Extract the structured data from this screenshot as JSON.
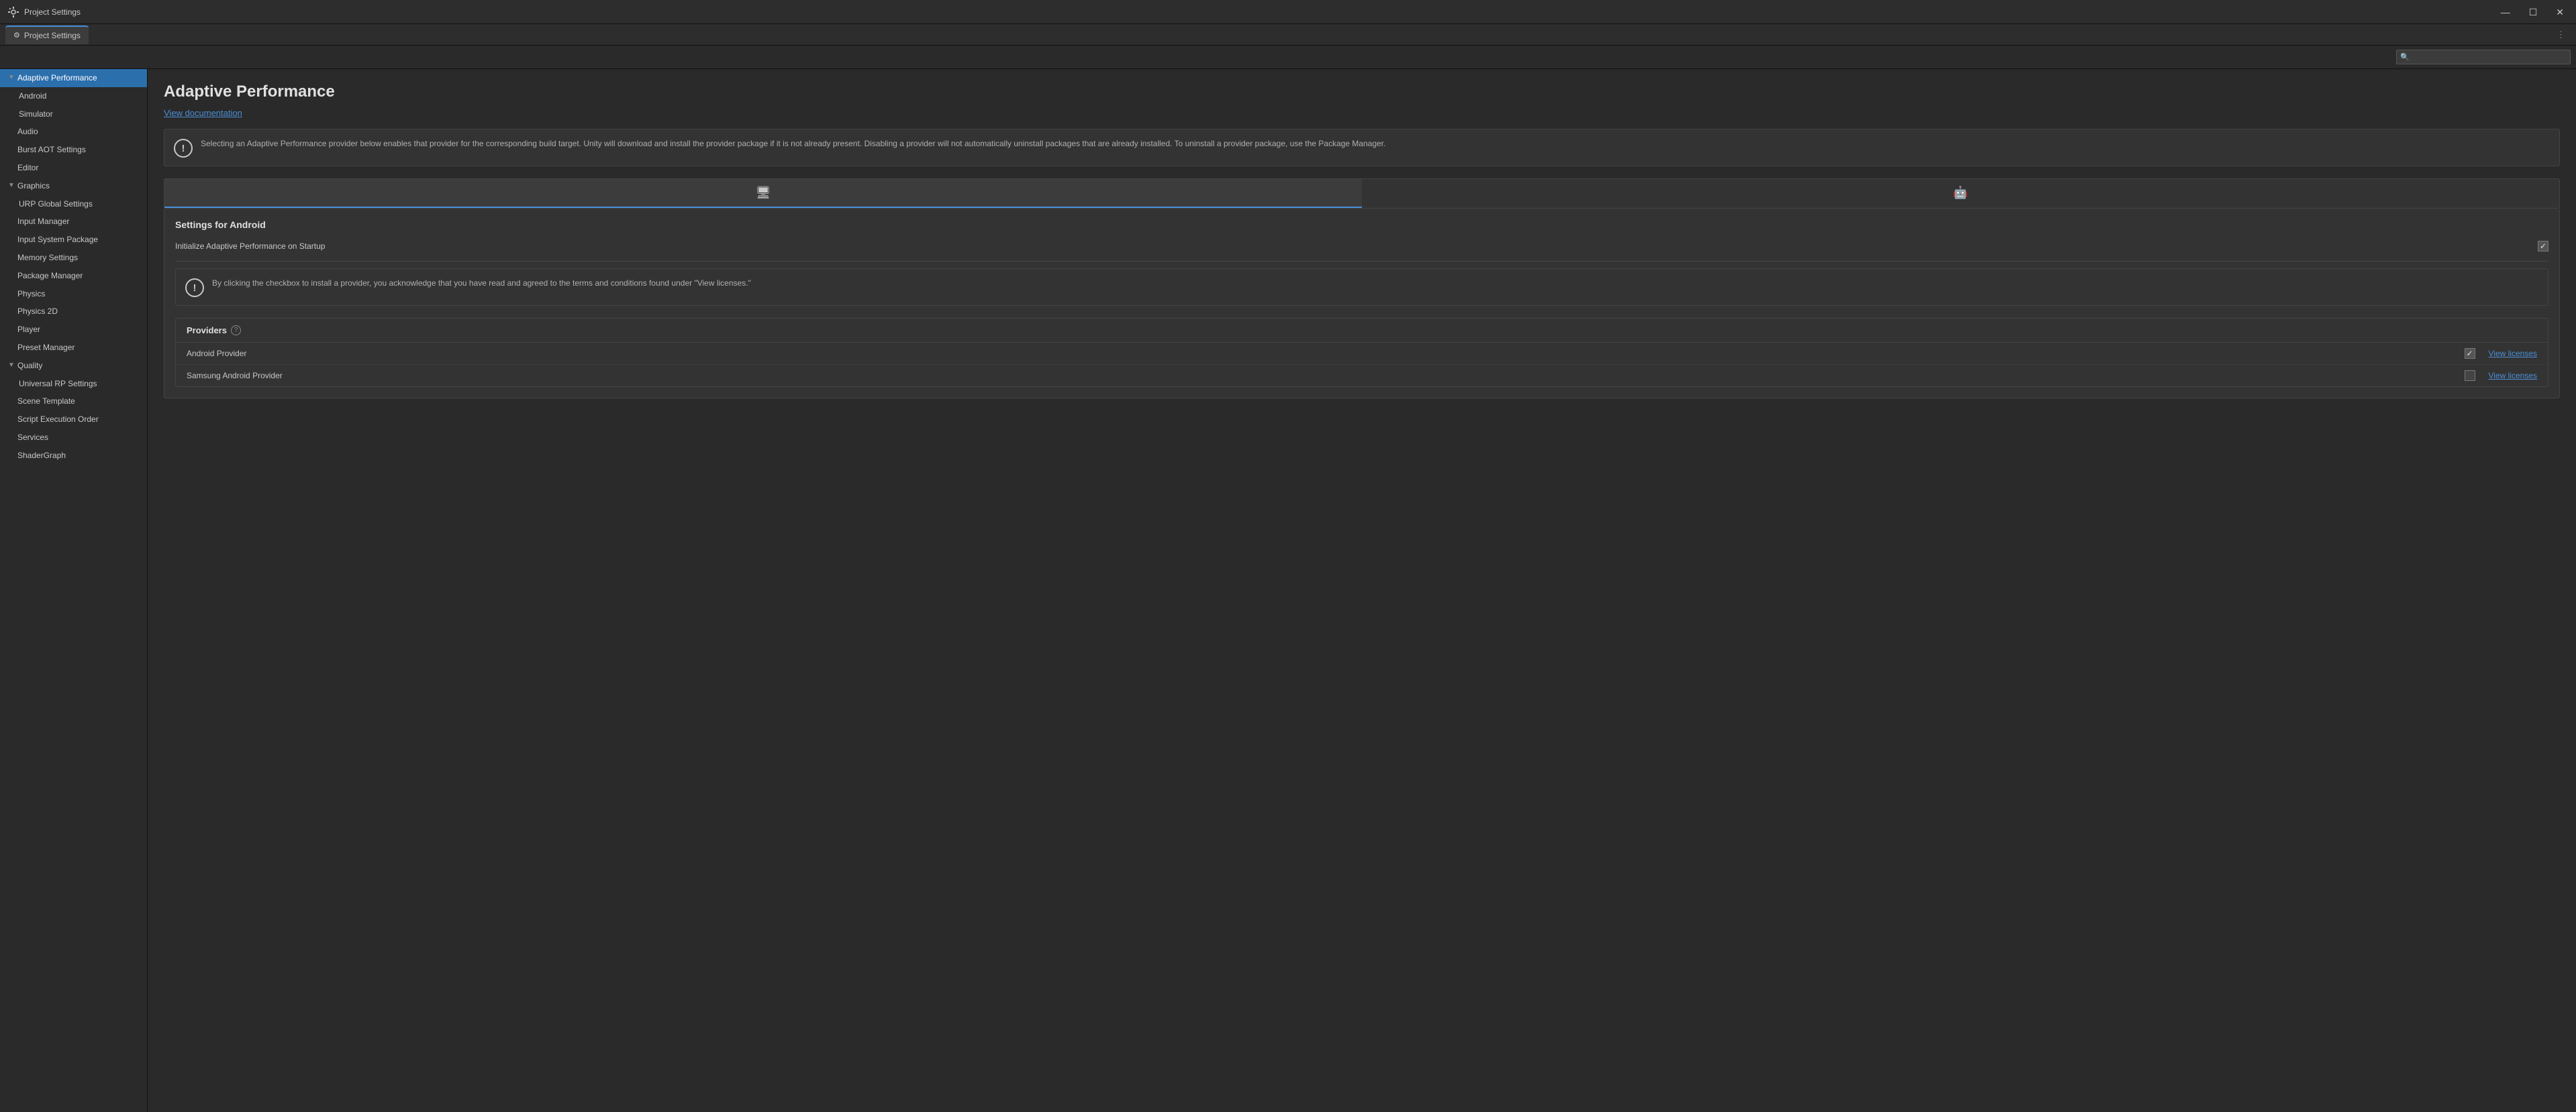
{
  "titleBar": {
    "icon": "⚙",
    "title": "Project Settings",
    "minimize": "—",
    "maximize": "☐",
    "close": "✕"
  },
  "tab": {
    "icon": "⚙",
    "label": "Project Settings",
    "more": "⋮"
  },
  "search": {
    "placeholder": "",
    "icon": "🔍"
  },
  "sidebar": {
    "items": [
      {
        "id": "adaptive-performance",
        "label": "Adaptive Performance",
        "level": 0,
        "hasArrow": true,
        "arrow": "▼",
        "active": true
      },
      {
        "id": "android",
        "label": "Android",
        "level": 1,
        "hasArrow": false
      },
      {
        "id": "simulator",
        "label": "Simulator",
        "level": 1,
        "hasArrow": false
      },
      {
        "id": "audio",
        "label": "Audio",
        "level": 0,
        "hasArrow": false
      },
      {
        "id": "burst-aot",
        "label": "Burst AOT Settings",
        "level": 0,
        "hasArrow": false
      },
      {
        "id": "editor",
        "label": "Editor",
        "level": 0,
        "hasArrow": false
      },
      {
        "id": "graphics",
        "label": "Graphics",
        "level": 0,
        "hasArrow": true,
        "arrow": "▼"
      },
      {
        "id": "urp-global",
        "label": "URP Global Settings",
        "level": 1,
        "hasArrow": false
      },
      {
        "id": "input-manager",
        "label": "Input Manager",
        "level": 0,
        "hasArrow": false
      },
      {
        "id": "input-system",
        "label": "Input System Package",
        "level": 0,
        "hasArrow": false
      },
      {
        "id": "memory-settings",
        "label": "Memory Settings",
        "level": 0,
        "hasArrow": false
      },
      {
        "id": "package-manager",
        "label": "Package Manager",
        "level": 0,
        "hasArrow": false
      },
      {
        "id": "physics",
        "label": "Physics",
        "level": 0,
        "hasArrow": false
      },
      {
        "id": "physics2d",
        "label": "Physics 2D",
        "level": 0,
        "hasArrow": false
      },
      {
        "id": "player",
        "label": "Player",
        "level": 0,
        "hasArrow": false
      },
      {
        "id": "preset-manager",
        "label": "Preset Manager",
        "level": 0,
        "hasArrow": false
      },
      {
        "id": "quality",
        "label": "Quality",
        "level": 0,
        "hasArrow": true,
        "arrow": "▼"
      },
      {
        "id": "universal-rp",
        "label": "Universal RP Settings",
        "level": 1,
        "hasArrow": false
      },
      {
        "id": "scene-template",
        "label": "Scene Template",
        "level": 0,
        "hasArrow": false
      },
      {
        "id": "script-execution",
        "label": "Script Execution Order",
        "level": 0,
        "hasArrow": false
      },
      {
        "id": "services",
        "label": "Services",
        "level": 0,
        "hasArrow": false
      },
      {
        "id": "shadergraph",
        "label": "ShaderGraph",
        "level": 0,
        "hasArrow": false
      }
    ]
  },
  "content": {
    "title": "Adaptive Performance",
    "viewDocs": "View documentation",
    "infoBox": "Selecting an Adaptive Performance provider below enables that provider for the corresponding build target. Unity will download and install the provider package if it is not already present. Disabling a provider will not automatically uninstall packages that are already installed. To uninstall a provider package, use the Package Manager.",
    "platformTabs": [
      {
        "id": "desktop",
        "icon": "🖥",
        "active": false
      },
      {
        "id": "android",
        "icon": "🤖",
        "active": true
      }
    ],
    "settingsTitle": "Settings for Android",
    "initLabel": "Initialize Adaptive Performance on Startup",
    "initChecked": true,
    "warningBox": "By clicking the checkbox to install a provider, you acknowledge that you have read and agreed to the terms and conditions found under \"View licenses.\"",
    "providersTitle": "Providers",
    "providers": [
      {
        "id": "android-provider",
        "name": "Android Provider",
        "checked": true,
        "viewLicenses": "View licenses"
      },
      {
        "id": "samsung-provider",
        "name": "Samsung Android Provider",
        "checked": false,
        "viewLicenses": "View licenses"
      }
    ]
  }
}
